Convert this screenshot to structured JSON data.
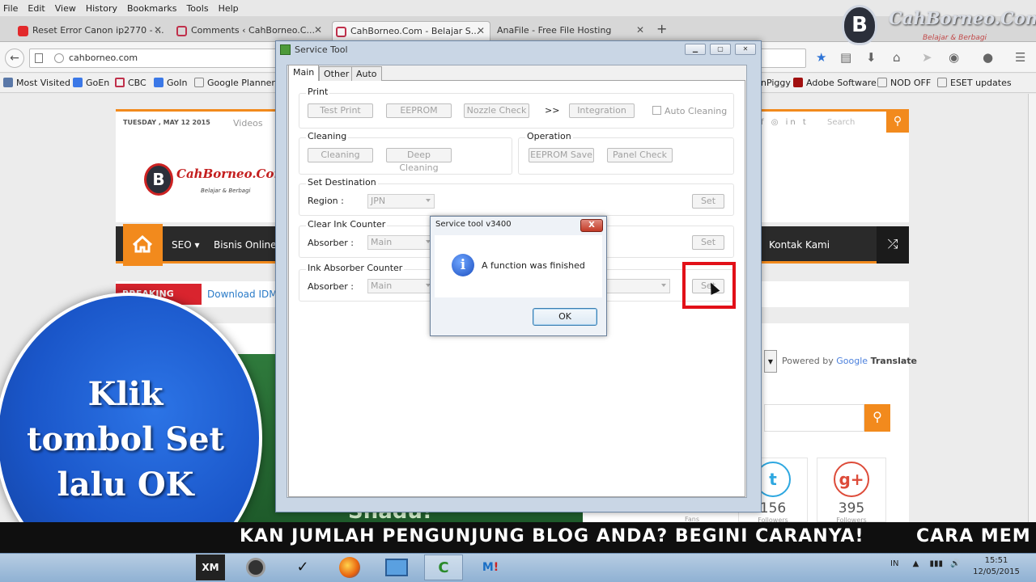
{
  "browser": {
    "menu": [
      "File",
      "Edit",
      "View",
      "History",
      "Bookmarks",
      "Tools",
      "Help"
    ],
    "tabs": [
      {
        "label": "Reset Error Canon ip2770 - ...",
        "color": "#e2292b"
      },
      {
        "label": "Comments ‹ CahBorneo.C...",
        "color": "#c0304b"
      },
      {
        "label": "CahBorneo.Com - Belajar S...",
        "color": "#c0304b"
      },
      {
        "label": "AnaFile - Free File Hosting",
        "color": ""
      }
    ],
    "new_tab": "+",
    "url": "cahborneo.com",
    "bookmarks": {
      "most_visited": "Most Visited",
      "goen": "GoEn",
      "cbc": "CBC",
      "goin": "GoIn",
      "google_planner": "Google Planner",
      "npiggy": "nPiggy",
      "adobe": "Adobe Software",
      "nod": "NOD OFF",
      "eset": "ESET updates"
    }
  },
  "site": {
    "date": "TUESDAY , MAY 12 2015",
    "videos": "Videos",
    "search_placeholder": "Search",
    "logo_text": "CahBorneo.Com",
    "logo_sub": "Belajar & Berbagi",
    "nav": {
      "seo": "SEO ▾",
      "bisnis": "Bisnis Online",
      "kontak": "Kontak Kami"
    },
    "breaking_label": "BREAKING NEWS",
    "breaking_text": "Download IDM 6",
    "green_word": "Shadu!",
    "powered_by": "Powered by",
    "google": "Google",
    "translate": "Translate",
    "social": [
      {
        "glyph": "t",
        "count": "156",
        "label": "Followers",
        "color": "#2da7e0"
      },
      {
        "glyph": "g+",
        "count": "395",
        "label": "Followers",
        "color": "#dd4b39"
      }
    ],
    "fans_label": "Fans"
  },
  "watermark": {
    "brand": "CahBorneo.Com",
    "sub": "Belajar & Berbagi"
  },
  "overlay": {
    "line1": "Klik",
    "line2": "tombol Set",
    "line3": "lalu OK"
  },
  "ticker": {
    "text1": "KAN JUMLAH PENGUNJUNG BLOG ANDA? BEGINI CARANYA!",
    "text2": "CARA MEM"
  },
  "service_tool": {
    "title": "Service Tool",
    "tabs": [
      "Main",
      "Other",
      "Auto"
    ],
    "print": {
      "label": "Print",
      "test_print": "Test Print",
      "eeprom": "EEPROM",
      "nozzle": "Nozzle Check",
      "arrow": ">>",
      "integration": "Integration",
      "auto_cleaning": "Auto Cleaning"
    },
    "cleaning": {
      "label": "Cleaning",
      "cleaning": "Cleaning",
      "deep": "Deep Cleaning"
    },
    "operation": {
      "label": "Operation",
      "eeprom_save": "EEPROM Save",
      "panel_check": "Panel Check"
    },
    "destination": {
      "label": "Set Destination",
      "region_label": "Region :",
      "region_value": "JPN",
      "set": "Set"
    },
    "clear_ink": {
      "label": "Clear Ink Counter",
      "absorber_label": "Absorber :",
      "absorber_value": "Main",
      "set": "Set"
    },
    "ink_absorber": {
      "label": "Ink Absorber Counter",
      "absorber_label": "Absorber :",
      "absorber_value": "Main",
      "set": "Set"
    }
  },
  "dialog": {
    "title": "Service tool v3400",
    "message": "A function was finished",
    "ok": "OK",
    "close": "X"
  },
  "taskbar": {
    "xm": "XM",
    "lang": "IN",
    "time": "15:51",
    "date": "12/05/2015"
  }
}
